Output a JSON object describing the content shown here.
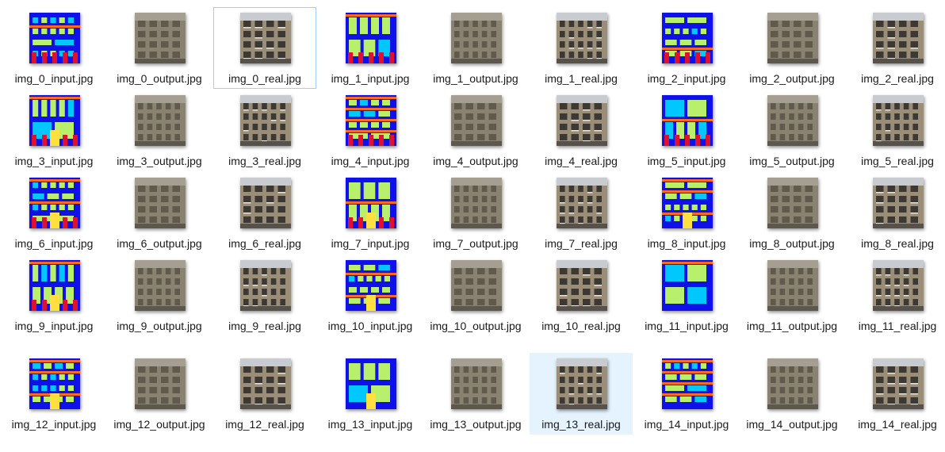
{
  "files": [
    {
      "name": "img_0_input.jpg",
      "kind": "input"
    },
    {
      "name": "img_0_output.jpg",
      "kind": "output"
    },
    {
      "name": "img_0_real.jpg",
      "kind": "real",
      "state": "focus"
    },
    {
      "name": "img_1_input.jpg",
      "kind": "input"
    },
    {
      "name": "img_1_output.jpg",
      "kind": "output"
    },
    {
      "name": "img_1_real.jpg",
      "kind": "real"
    },
    {
      "name": "img_2_input.jpg",
      "kind": "input"
    },
    {
      "name": "img_2_output.jpg",
      "kind": "output"
    },
    {
      "name": "img_2_real.jpg",
      "kind": "real"
    },
    {
      "name": "img_3_input.jpg",
      "kind": "input"
    },
    {
      "name": "img_3_output.jpg",
      "kind": "output"
    },
    {
      "name": "img_3_real.jpg",
      "kind": "real"
    },
    {
      "name": "img_4_input.jpg",
      "kind": "input"
    },
    {
      "name": "img_4_output.jpg",
      "kind": "output"
    },
    {
      "name": "img_4_real.jpg",
      "kind": "real"
    },
    {
      "name": "img_5_input.jpg",
      "kind": "input"
    },
    {
      "name": "img_5_output.jpg",
      "kind": "output"
    },
    {
      "name": "img_5_real.jpg",
      "kind": "real"
    },
    {
      "name": "img_6_input.jpg",
      "kind": "input"
    },
    {
      "name": "img_6_output.jpg",
      "kind": "output"
    },
    {
      "name": "img_6_real.jpg",
      "kind": "real"
    },
    {
      "name": "img_7_input.jpg",
      "kind": "input"
    },
    {
      "name": "img_7_output.jpg",
      "kind": "output"
    },
    {
      "name": "img_7_real.jpg",
      "kind": "real"
    },
    {
      "name": "img_8_input.jpg",
      "kind": "input"
    },
    {
      "name": "img_8_output.jpg",
      "kind": "output"
    },
    {
      "name": "img_8_real.jpg",
      "kind": "real"
    },
    {
      "name": "img_9_input.jpg",
      "kind": "input"
    },
    {
      "name": "img_9_output.jpg",
      "kind": "output"
    },
    {
      "name": "img_9_real.jpg",
      "kind": "real"
    },
    {
      "name": "img_10_input.jpg",
      "kind": "input"
    },
    {
      "name": "img_10_output.jpg",
      "kind": "output"
    },
    {
      "name": "img_10_real.jpg",
      "kind": "real"
    },
    {
      "name": "img_11_input.jpg",
      "kind": "input"
    },
    {
      "name": "img_11_output.jpg",
      "kind": "output"
    },
    {
      "name": "img_11_real.jpg",
      "kind": "real"
    },
    {
      "name": "img_12_input.jpg",
      "kind": "input"
    },
    {
      "name": "img_12_output.jpg",
      "kind": "output"
    },
    {
      "name": "img_12_real.jpg",
      "kind": "real"
    },
    {
      "name": "img_13_input.jpg",
      "kind": "input"
    },
    {
      "name": "img_13_output.jpg",
      "kind": "output"
    },
    {
      "name": "img_13_real.jpg",
      "kind": "real",
      "state": "selected"
    },
    {
      "name": "img_14_input.jpg",
      "kind": "input"
    },
    {
      "name": "img_14_output.jpg",
      "kind": "output"
    },
    {
      "name": "img_14_real.jpg",
      "kind": "real"
    }
  ],
  "palette": {
    "label_facade_bg": "#1010e8",
    "label_window": "#b8f06c",
    "label_cornice": "#ff6a1a",
    "label_pillar": "#e01030",
    "label_balcony": "#00c8ff",
    "label_door": "#ffe040",
    "output_stone": "#8a8270",
    "real_stone": "#9a8e78",
    "focus_border": "#99d1ff",
    "selected_bg": "#e5f3ff"
  }
}
